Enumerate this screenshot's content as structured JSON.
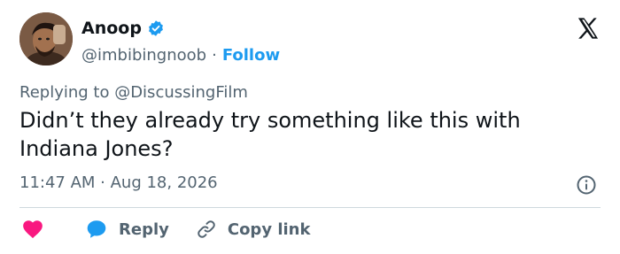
{
  "author": {
    "name": "Anoop",
    "handle": "@imbibingnoob",
    "separator": "·",
    "follow_label": "Follow"
  },
  "tweet": {
    "replying_to": "Replying to @DiscussingFilm",
    "text": "Didn’t they already try something like this with Indiana Jones?",
    "timestamp": "11:47 AM · Aug 18, 2026"
  },
  "actions": {
    "reply_label": "Reply",
    "copy_link_label": "Copy link"
  },
  "icons": {
    "verified": "verified-badge-icon",
    "platform_logo": "x-logo-icon",
    "info": "info-icon",
    "like": "heart-icon",
    "reply": "reply-bubble-icon",
    "copy_link": "link-icon"
  },
  "colors": {
    "accent": "#1d9bf0",
    "like": "#f91880",
    "text": "#0f1419",
    "secondary": "#536471",
    "divider": "#cfd9de"
  }
}
